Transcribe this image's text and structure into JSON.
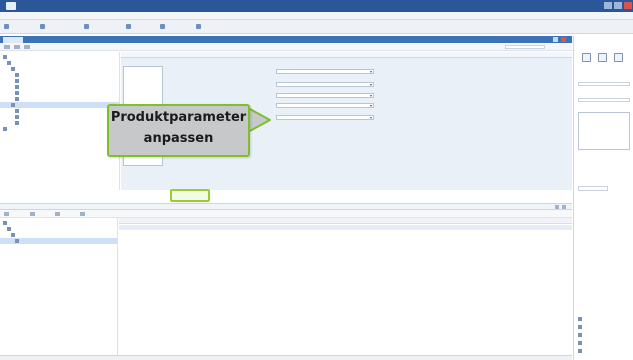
{
  "app": {
    "title_text": "",
    "menus": [
      "",
      "",
      "",
      "",
      "",
      ""
    ],
    "toolbar_items": [
      "",
      "",
      "",
      "",
      "",
      ""
    ]
  },
  "editor": {
    "tab_label": "",
    "tree_items": [
      {
        "label": "",
        "level": 0
      },
      {
        "label": "",
        "level": 1
      },
      {
        "label": "",
        "level": 2
      },
      {
        "label": "",
        "level": 3
      },
      {
        "label": "",
        "level": 3
      },
      {
        "label": "",
        "level": 3
      },
      {
        "label": "",
        "level": 3
      },
      {
        "label": "",
        "level": 3
      },
      {
        "label": "",
        "level": 2
      },
      {
        "label": "",
        "level": 3
      },
      {
        "label": "",
        "level": 3
      },
      {
        "label": "",
        "level": 3
      },
      {
        "label": "",
        "level": 0
      }
    ]
  },
  "dialog": {
    "list_items": [
      "",
      "",
      "",
      ""
    ],
    "fields": [
      {
        "label": "",
        "value": ""
      },
      {
        "label": "",
        "value": ""
      },
      {
        "label": "",
        "value": ""
      },
      {
        "label": "",
        "value": ""
      },
      {
        "label": "",
        "value": ""
      }
    ],
    "ok_label": "",
    "hint": ""
  },
  "callout": {
    "line1": "Produktparameter",
    "line2": "anpassen",
    "border_color": "#7fbf2a"
  },
  "bottom": {
    "tab_label": "",
    "tree_items": [
      "",
      "",
      "",
      ""
    ],
    "columns": [
      "",
      "",
      "",
      "",
      "",
      "",
      "",
      "",
      ""
    ],
    "rows": [
      [
        "",
        "",
        "",
        "",
        "",
        "",
        "",
        "",
        ""
      ],
      [
        "",
        "",
        "",
        "",
        "",
        "",
        "",
        "",
        ""
      ]
    ]
  },
  "right_panel": {
    "fields": [
      "",
      "",
      "",
      "",
      "",
      ""
    ],
    "links": [
      "",
      "",
      "",
      "",
      ""
    ]
  },
  "colors": {
    "titlebar": "#2b579a",
    "accent": "#3b73b9",
    "highlight": "#9acd32"
  }
}
